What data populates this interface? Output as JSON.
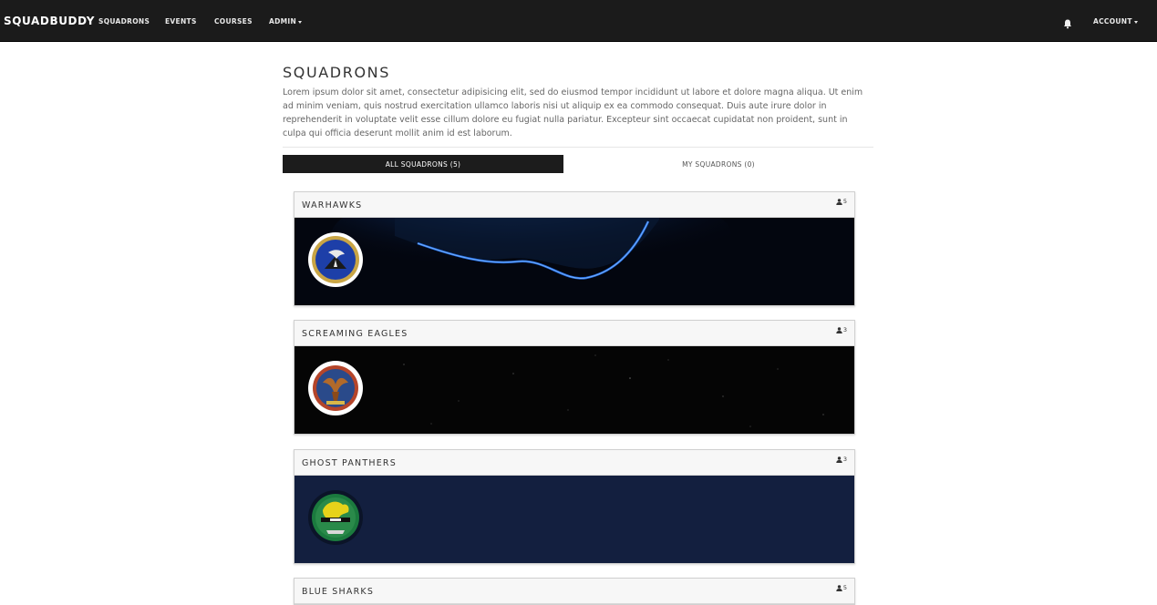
{
  "nav": {
    "brand": "SQUADBUDDY",
    "links": [
      "SQUADRONS",
      "EVENTS",
      "COURSES",
      "ADMIN"
    ],
    "account": "ACCOUNT"
  },
  "page": {
    "title": "SQUADRONS",
    "description": "Lorem ipsum dolor sit amet, consectetur adipisicing elit, sed do eiusmod tempor incididunt ut labore et dolore magna aliqua. Ut enim ad minim veniam, quis nostrud exercitation ullamco laboris nisi ut aliquip ex ea commodo consequat. Duis aute irure dolor in reprehenderit in voluptate velit esse cillum dolore eu fugiat nulla pariatur. Excepteur sint occaecat cupidatat non proident, sunt in culpa qui officia deserunt mollit anim id est laborum."
  },
  "tabs": {
    "all": "ALL SQUADRONS (5)",
    "mine": "MY SQUADRONS (0)"
  },
  "squadrons": [
    {
      "name": "WARHAWKS",
      "members": "5"
    },
    {
      "name": "SCREAMING EAGLES",
      "members": "3"
    },
    {
      "name": "GHOST PANTHERS",
      "members": "3"
    },
    {
      "name": "BLUE SHARKS",
      "members": "5"
    }
  ],
  "colors": {
    "navbar": "#1b1b1b",
    "active_tab": "#1c1c1c",
    "ghost_panthers_banner": "#131f3f"
  }
}
